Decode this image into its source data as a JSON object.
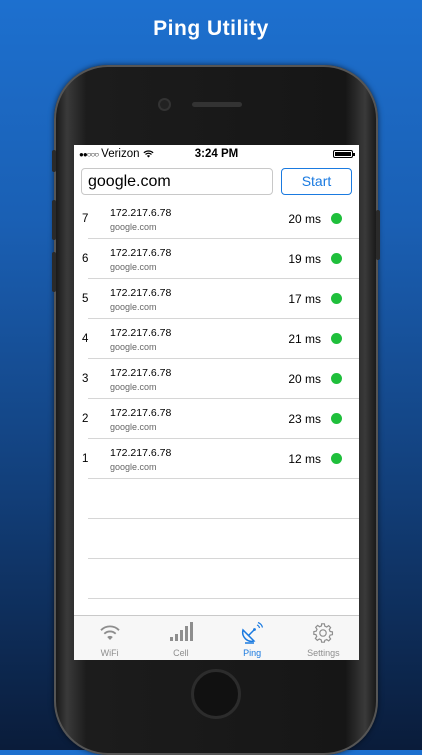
{
  "promo": {
    "title": "Ping Utility"
  },
  "status_bar": {
    "carrier": "Verizon",
    "time": "3:24 PM",
    "signal": "●●○○○"
  },
  "search": {
    "value": "google.com"
  },
  "start_button": {
    "label": "Start"
  },
  "pings": [
    {
      "seq": "7",
      "ip": "172.217.6.78",
      "host": "google.com",
      "time": "20 ms"
    },
    {
      "seq": "6",
      "ip": "172.217.6.78",
      "host": "google.com",
      "time": "19 ms"
    },
    {
      "seq": "5",
      "ip": "172.217.6.78",
      "host": "google.com",
      "time": "17 ms"
    },
    {
      "seq": "4",
      "ip": "172.217.6.78",
      "host": "google.com",
      "time": "21 ms"
    },
    {
      "seq": "3",
      "ip": "172.217.6.78",
      "host": "google.com",
      "time": "20 ms"
    },
    {
      "seq": "2",
      "ip": "172.217.6.78",
      "host": "google.com",
      "time": "23 ms"
    },
    {
      "seq": "1",
      "ip": "172.217.6.78",
      "host": "google.com",
      "time": "12 ms"
    }
  ],
  "tabs": [
    {
      "label": "WiFi",
      "icon": "wifi-icon",
      "active": false
    },
    {
      "label": "Cell",
      "icon": "cell-signal-icon",
      "active": false
    },
    {
      "label": "Ping",
      "icon": "satellite-dish-icon",
      "active": true
    },
    {
      "label": "Settings",
      "icon": "gear-icon",
      "active": false
    }
  ],
  "colors": {
    "accent": "#1a7ae0",
    "status_ok": "#1fbf3b",
    "background_top": "#1d70cf",
    "background_bottom": "#0a1c3a"
  }
}
